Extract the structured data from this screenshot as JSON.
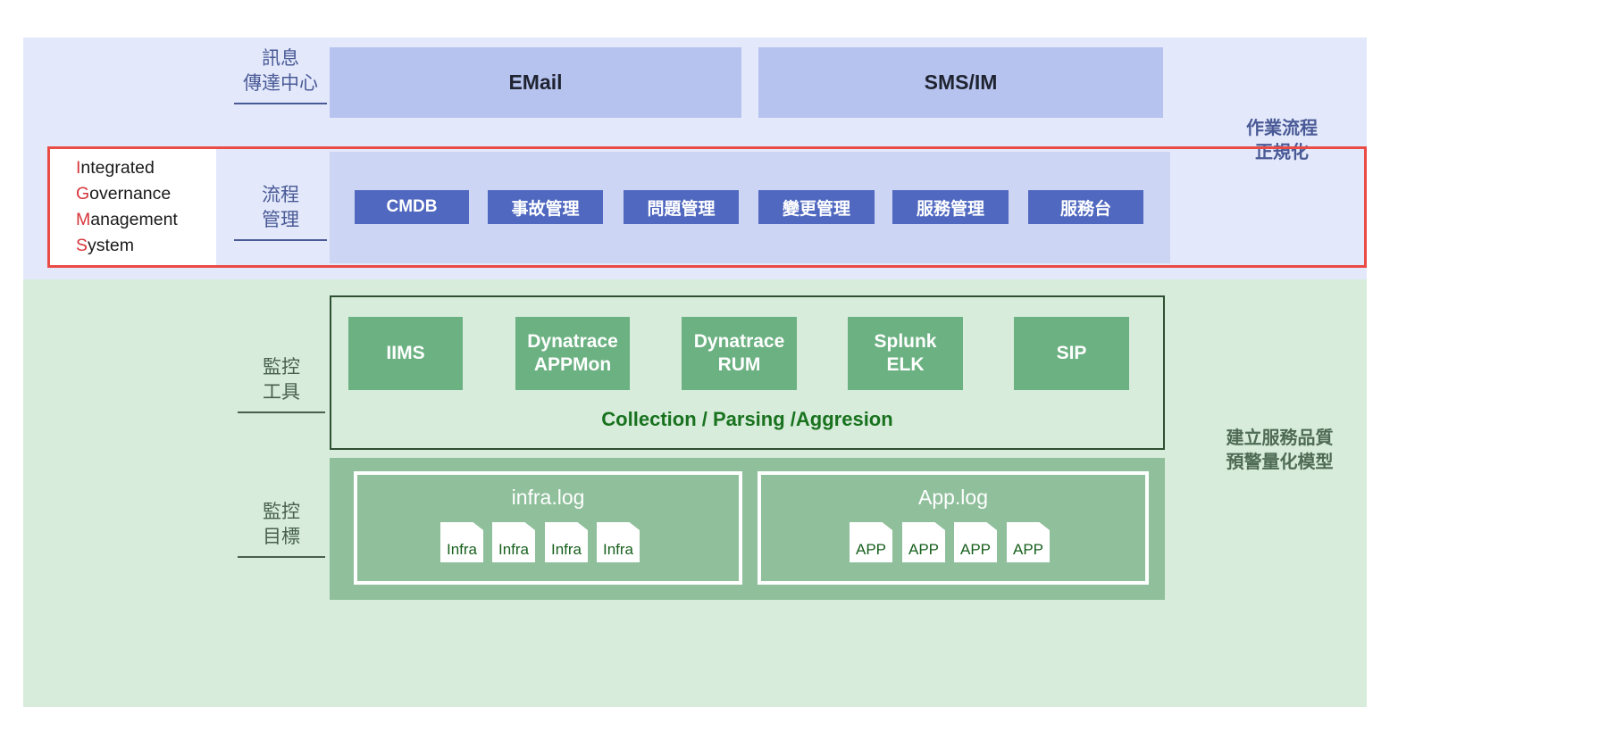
{
  "bands": {
    "top": {
      "name": "operations-band",
      "color": "#e3e9fb"
    },
    "bottom": {
      "name": "monitoring-band",
      "color": "#d7ecdb"
    }
  },
  "side_labels": {
    "message_center": "訊息\n傳達中心",
    "process_management": "流程\n管理",
    "monitoring_tools": "監控\n工具",
    "monitoring_targets": "監控\n目標"
  },
  "right_labels": {
    "top": "作業流程\n正規化",
    "bottom": "建立服務品質\n預警量化模型"
  },
  "channels": [
    {
      "label": "EMail"
    },
    {
      "label": "SMS/IM"
    }
  ],
  "igms": {
    "lines": [
      {
        "cap": "I",
        "rest": "ntegrated"
      },
      {
        "cap": "G",
        "rest": "overnance"
      },
      {
        "cap": "M",
        "rest": "anagement"
      },
      {
        "cap": "S",
        "rest": "ystem"
      }
    ],
    "accent_color": "#d6353a"
  },
  "process_buttons": [
    {
      "label": "CMDB"
    },
    {
      "label": "事故管理"
    },
    {
      "label": "問題管理"
    },
    {
      "label": "變更管理"
    },
    {
      "label": "服務管理"
    },
    {
      "label": "服務台"
    }
  ],
  "monitoring_tools": {
    "boxes": [
      {
        "label": "IIMS"
      },
      {
        "label": "Dynatrace\nAPPMon"
      },
      {
        "label": "Dynatrace\nRUM"
      },
      {
        "label": "Splunk\nELK"
      },
      {
        "label": "SIP"
      }
    ],
    "caption": "Collection / Parsing /Aggresion",
    "caption_color": "#18721e"
  },
  "monitoring_targets": {
    "groups": [
      {
        "title": "infra.log",
        "items": [
          {
            "label": "Infra"
          },
          {
            "label": "Infra"
          },
          {
            "label": "Infra"
          },
          {
            "label": "Infra"
          }
        ]
      },
      {
        "title": "App.log",
        "items": [
          {
            "label": "APP"
          },
          {
            "label": "APP"
          },
          {
            "label": "APP"
          },
          {
            "label": "APP"
          }
        ]
      }
    ]
  }
}
